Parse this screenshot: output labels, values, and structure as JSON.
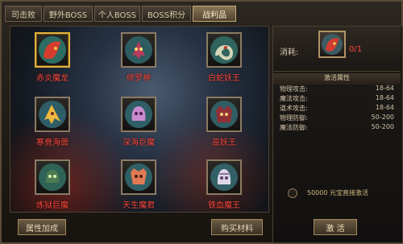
{
  "tabs": [
    "司击败",
    "野外BOSS",
    "个人BOSS",
    "BOSS积分",
    "战利品"
  ],
  "cards": [
    {
      "name": "赤炎魔龙"
    },
    {
      "name": "修罗神"
    },
    {
      "name": "白蛇妖王"
    },
    {
      "name": "寒竟海兽"
    },
    {
      "name": "深海巨魔"
    },
    {
      "name": "巫妖王"
    },
    {
      "name": "炼狱巨魔"
    },
    {
      "name": "天生魔君"
    },
    {
      "name": "铁血魔王"
    }
  ],
  "buttons": {
    "attribute_bonus": "属性加成",
    "buy_materials": "购买材料",
    "activate": "激  活"
  },
  "right_panel": {
    "cost_label": "消耗:",
    "cost_count": "0/1",
    "stat_title": "激活属性",
    "stats": [
      {
        "label": "物理攻击:",
        "value": "18-64"
      },
      {
        "label": "魔法攻击:",
        "value": "18-64"
      },
      {
        "label": "道术攻击:",
        "value": "18-64"
      },
      {
        "label": "物理防御:",
        "value": "50-200"
      },
      {
        "label": "魔法防御:",
        "value": "50-200"
      }
    ],
    "direct_activate": "50000  元宝直接激活"
  }
}
